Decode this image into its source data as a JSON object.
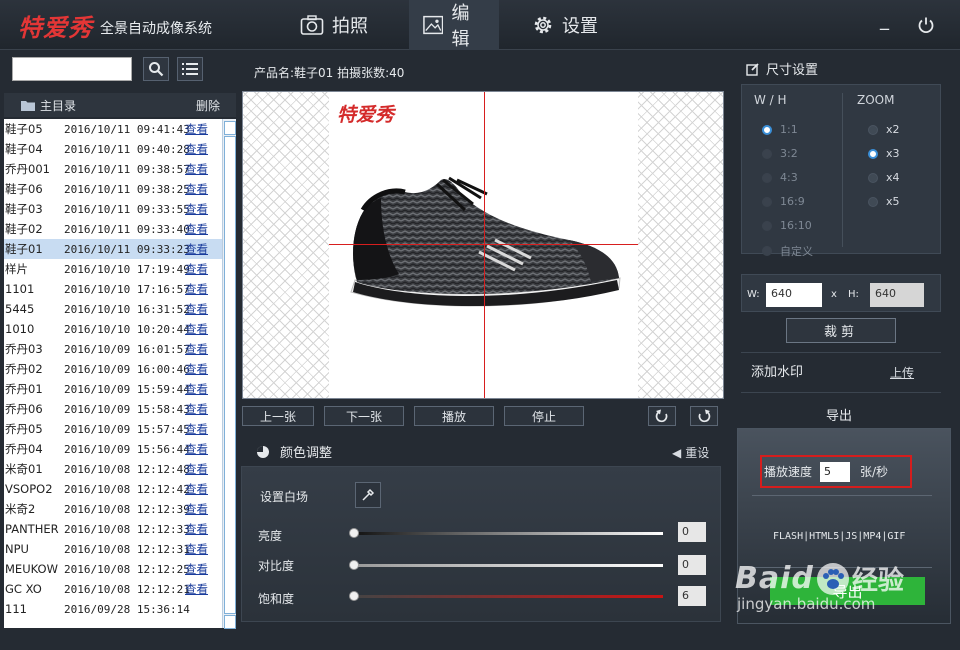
{
  "app": {
    "logo": "特爱秀",
    "subtitle": "全景自动成像系统",
    "tabs": [
      {
        "label": "拍照"
      },
      {
        "label": "编辑"
      },
      {
        "label": "设置"
      }
    ],
    "minimize": "_",
    "power": "⏻"
  },
  "left": {
    "search_value": "",
    "tree_root": "主目录",
    "delete": "删除",
    "view_label": "查看",
    "rows": [
      {
        "name": "鞋子05",
        "time": "2016/10/11 09:41:43"
      },
      {
        "name": "鞋子04",
        "time": "2016/10/11 09:40:28"
      },
      {
        "name": "乔丹001",
        "time": "2016/10/11 09:38:57"
      },
      {
        "name": "鞋子06",
        "time": "2016/10/11 09:38:25"
      },
      {
        "name": "鞋子03",
        "time": "2016/10/11 09:33:55"
      },
      {
        "name": "鞋子02",
        "time": "2016/10/11 09:33:40"
      },
      {
        "name": "鞋子01",
        "time": "2016/10/11 09:33:23"
      },
      {
        "name": "样片",
        "time": "2016/10/10 17:19:49"
      },
      {
        "name": "1101",
        "time": "2016/10/10 17:16:57"
      },
      {
        "name": "5445",
        "time": "2016/10/10 16:31:52"
      },
      {
        "name": "1010",
        "time": "2016/10/10 10:20:44"
      },
      {
        "name": "乔丹03",
        "time": "2016/10/09 16:01:57"
      },
      {
        "name": "乔丹02",
        "time": "2016/10/09 16:00:46"
      },
      {
        "name": "乔丹01",
        "time": "2016/10/09 15:59:44"
      },
      {
        "name": "乔丹06",
        "time": "2016/10/09 15:58:43"
      },
      {
        "name": "乔丹05",
        "time": "2016/10/09 15:57:45"
      },
      {
        "name": "乔丹04",
        "time": "2016/10/09 15:56:44"
      },
      {
        "name": "米奇01",
        "time": "2016/10/08 12:12:48"
      },
      {
        "name": "VSOPO2",
        "time": "2016/10/08 12:12:42"
      },
      {
        "name": "米奇2",
        "time": "2016/10/08 12:12:39"
      },
      {
        "name": "PANTHER",
        "time": "2016/10/08 12:12:33"
      },
      {
        "name": "NPU",
        "time": "2016/10/08 12:12:31"
      },
      {
        "name": "MEUKOW",
        "time": "2016/10/08 12:12:25"
      },
      {
        "name": "GC XO",
        "time": "2016/10/08 12:12:21"
      },
      {
        "name": "111",
        "time": "2016/09/28 15:36:14"
      }
    ],
    "selected_index": 6
  },
  "center": {
    "product_info": "产品名:鞋子01  拍摄张数:40",
    "canvas_logo": "特爱秀",
    "buttons": {
      "prev": "上一张",
      "next": "下一张",
      "play": "播放",
      "stop": "停止"
    },
    "color": {
      "title": "颜色调整",
      "reset": "重设",
      "white_label": "设置白场",
      "sliders": [
        {
          "label": "亮度",
          "value": "0",
          "level": 0
        },
        {
          "label": "对比度",
          "value": "0",
          "level": 0
        },
        {
          "label": "饱和度",
          "value": "6",
          "level": 0
        }
      ]
    }
  },
  "right": {
    "size_title": "尺寸设置",
    "wh_head": "W / H",
    "zoom_head": "ZOOM",
    "ratios": [
      {
        "label": "1:1",
        "on": true
      },
      {
        "label": "3:2",
        "on": false
      },
      {
        "label": "4:3",
        "on": false
      },
      {
        "label": "16:9",
        "on": false
      },
      {
        "label": "16:10",
        "on": false
      },
      {
        "label": "自定义",
        "on": false
      }
    ],
    "zooms": [
      {
        "label": "x2",
        "on": false
      },
      {
        "label": "x3",
        "on": true
      },
      {
        "label": "x4",
        "on": false
      },
      {
        "label": "x5",
        "on": false
      }
    ],
    "w_label": "W:",
    "w_value": "640",
    "x_sep": "x",
    "h_label": "H:",
    "h_value": "640",
    "crop": "裁剪",
    "watermark": "添加水印",
    "upload": "上传",
    "export_title": "导出",
    "speed_label": "播放速度",
    "speed_value": "5",
    "speed_unit": "张/秒",
    "formats": "FLASH|HTML5|JS|MP4|GIF",
    "export_button": "导出"
  },
  "overlay": {
    "baidu_text": "Baid",
    "baidu_text2": "经验",
    "baidu_url": "jingyan.baidu.com"
  }
}
